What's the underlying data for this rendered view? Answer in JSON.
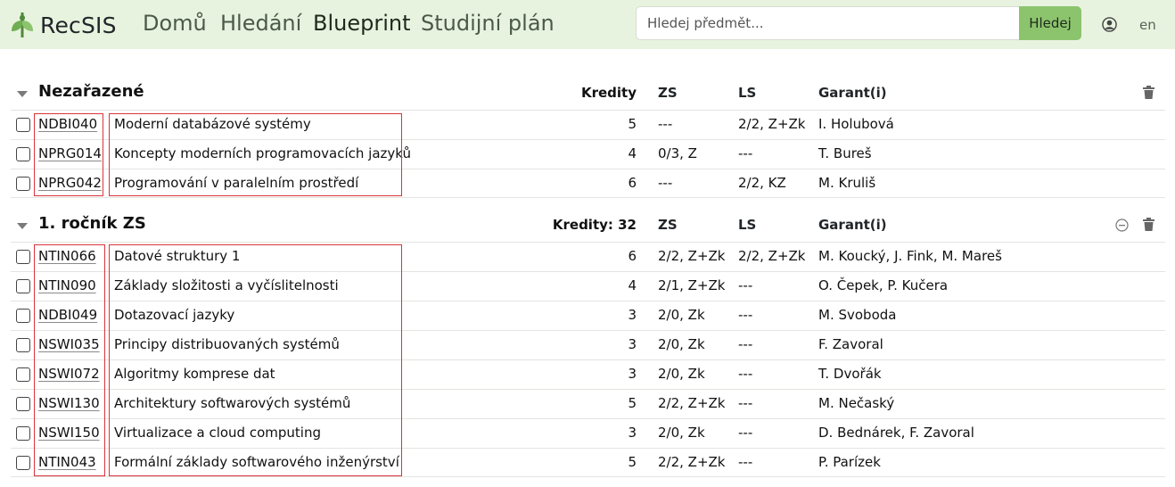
{
  "header": {
    "brand": "RecSIS",
    "nav": [
      {
        "label": "Domů"
      },
      {
        "label": "Hledání"
      },
      {
        "label": "Blueprint",
        "active": true
      },
      {
        "label": "Studijní plán"
      }
    ],
    "search": {
      "placeholder": "Hledej předmět...",
      "value": "",
      "button": "Hledej"
    },
    "user_icon": "user-circle-icon",
    "lang": "en",
    "accent_color": "#8cc46e",
    "bar_color": "#e8f3df"
  },
  "sections": [
    {
      "title": "Nezařazené",
      "credits_header": "Kredity",
      "zs_header": "ZS",
      "ls_header": "LS",
      "garant_header": "Garant(i)",
      "rows": [
        {
          "code": "NDBI040",
          "name": "Moderní databázové systémy",
          "credits": "5",
          "zs": "---",
          "ls": "2/2, Z+Zk",
          "garant": "I. Holubová"
        },
        {
          "code": "NPRG014",
          "name": "Koncepty moderních programovacích jazyků",
          "credits": "4",
          "zs": "0/3, Z",
          "ls": "---",
          "garant": "T. Bureš"
        },
        {
          "code": "NPRG042",
          "name": "Programování v paralelním prostředí",
          "credits": "6",
          "zs": "---",
          "ls": "2/2, KZ",
          "garant": "M. Kruliš"
        }
      ]
    },
    {
      "title": "1. ročník ZS",
      "credits_header": "Kredity: 32",
      "zs_header": "ZS",
      "ls_header": "LS",
      "garant_header": "Garant(i)",
      "rows": [
        {
          "code": "NTIN066",
          "name": "Datové struktury 1",
          "credits": "6",
          "zs": "2/2, Z+Zk",
          "ls": "2/2, Z+Zk",
          "garant": "M. Koucký, J. Fink, M. Mareš"
        },
        {
          "code": "NTIN090",
          "name": "Základy složitosti a vyčíslitelnosti",
          "credits": "4",
          "zs": "2/1, Z+Zk",
          "ls": "---",
          "garant": "O. Čepek, P. Kučera"
        },
        {
          "code": "NDBI049",
          "name": "Dotazovací jazyky",
          "credits": "3",
          "zs": "2/0, Zk",
          "ls": "---",
          "garant": "M. Svoboda"
        },
        {
          "code": "NSWI035",
          "name": "Principy distribuovaných systémů",
          "credits": "3",
          "zs": "2/0, Zk",
          "ls": "---",
          "garant": "F. Zavoral"
        },
        {
          "code": "NSWI072",
          "name": "Algoritmy komprese dat",
          "credits": "3",
          "zs": "2/0, Zk",
          "ls": "---",
          "garant": "T. Dvořák"
        },
        {
          "code": "NSWI130",
          "name": "Architektury softwarových systémů",
          "credits": "5",
          "zs": "2/2, Z+Zk",
          "ls": "---",
          "garant": "M. Nečaský"
        },
        {
          "code": "NSWI150",
          "name": "Virtualizace a cloud computing",
          "credits": "3",
          "zs": "2/0, Zk",
          "ls": "---",
          "garant": "D. Bednárek, F. Zavoral"
        },
        {
          "code": "NTIN043",
          "name": "Formální základy softwarového inženýrství",
          "credits": "5",
          "zs": "2/2, Z+Zk",
          "ls": "---",
          "garant": "P. Parízek"
        }
      ]
    }
  ]
}
